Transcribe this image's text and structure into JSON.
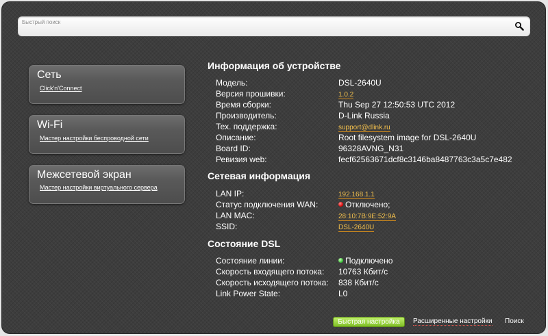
{
  "search": {
    "placeholder": "Быстрый поиск"
  },
  "nav_cards": [
    {
      "title": "Сеть",
      "link": "Click'n'Connect"
    },
    {
      "title": "Wi-Fi",
      "link": "Мастер настройки беспроводной сети"
    },
    {
      "title": "Межсетевой экран",
      "link": "Мастер настройки виртуального сервера"
    }
  ],
  "device_info": {
    "title": "Информация об устройстве",
    "rows": [
      {
        "label": "Модель:",
        "value": "DSL-2640U"
      },
      {
        "label": "Версия прошивки:",
        "value": "1.0.2"
      },
      {
        "label": "Время сборки:",
        "value": "Thu Sep 27 12:50:53 UTC 2012"
      },
      {
        "label": "Производитель:",
        "value": "D-Link Russia"
      },
      {
        "label": "Тех. поддержка:",
        "value": "support@dlink.ru"
      },
      {
        "label": "Описание:",
        "value": "Root filesystem image for DSL-2640U"
      },
      {
        "label": "Board ID:",
        "value": "96328AVNG_N31"
      },
      {
        "label": "Ревизия web:",
        "value": "fecf62563671dcf8c3146ba8487763c3a5c7e482"
      }
    ]
  },
  "network_info": {
    "title": "Сетевая информация",
    "rows": [
      {
        "label": "LAN IP:",
        "value": "192.168.1.1"
      },
      {
        "label": "Статус подключения WAN:",
        "value": "Отключено;"
      },
      {
        "label": "LAN MAC:",
        "value": "28:10:7B:9E:52:9A"
      },
      {
        "label": "SSID:",
        "value": "DSL-2640U"
      }
    ]
  },
  "dsl_state": {
    "title": "Состояние DSL",
    "rows": [
      {
        "label": "Состояние линии:",
        "value": "Подключено"
      },
      {
        "label": "Скорость входящего потока:",
        "value": "10763 Кбит/с"
      },
      {
        "label": "Скорость исходящего потока:",
        "value": "838 Кбит/с"
      },
      {
        "label": "Link Power State:",
        "value": "L0"
      }
    ]
  },
  "footer": {
    "quick_setup": "Быстрая настройка",
    "advanced": "Расширенные настройки",
    "search": "Поиск"
  },
  "colors": {
    "link_yellow": "#f3c04d",
    "status_disconnected": "#d40000",
    "status_connected": "#2fb82f",
    "button_green": "#7fbe26"
  },
  "icons": {
    "search": "magnifier-icon"
  }
}
